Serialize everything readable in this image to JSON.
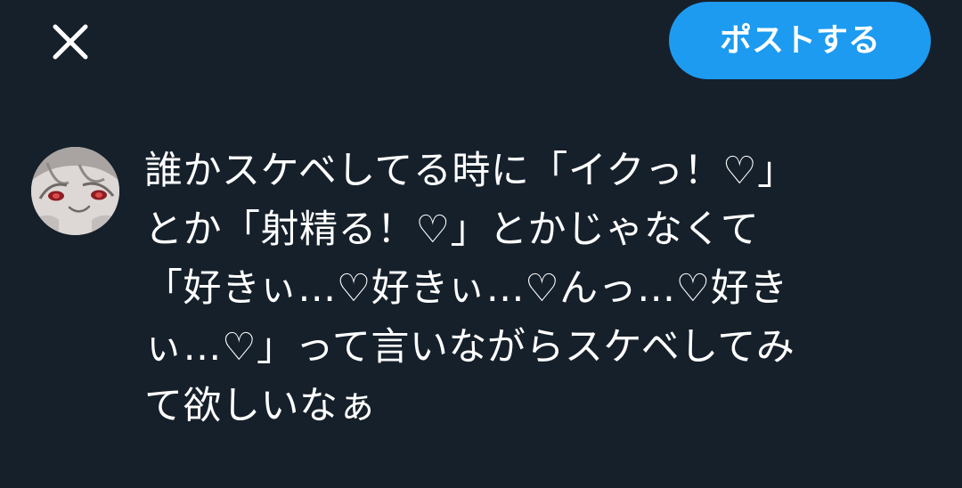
{
  "header": {
    "close_icon": "close-icon",
    "post_label": "ポストする",
    "accent_color": "#1d9bf0"
  },
  "composer": {
    "avatar_icon": "user-avatar",
    "text_lines": [
      "誰かスケベしてる時に「イクっ！♡」",
      "とか「射精る！♡」とかじゃなくて",
      "「好きぃ…♡好きぃ…♡んっ…♡好き",
      "ぃ…♡」って言いながらスケベしてみ",
      "て欲しいなぁ"
    ]
  },
  "colors": {
    "background": "#16202b",
    "text": "#ffffff"
  }
}
